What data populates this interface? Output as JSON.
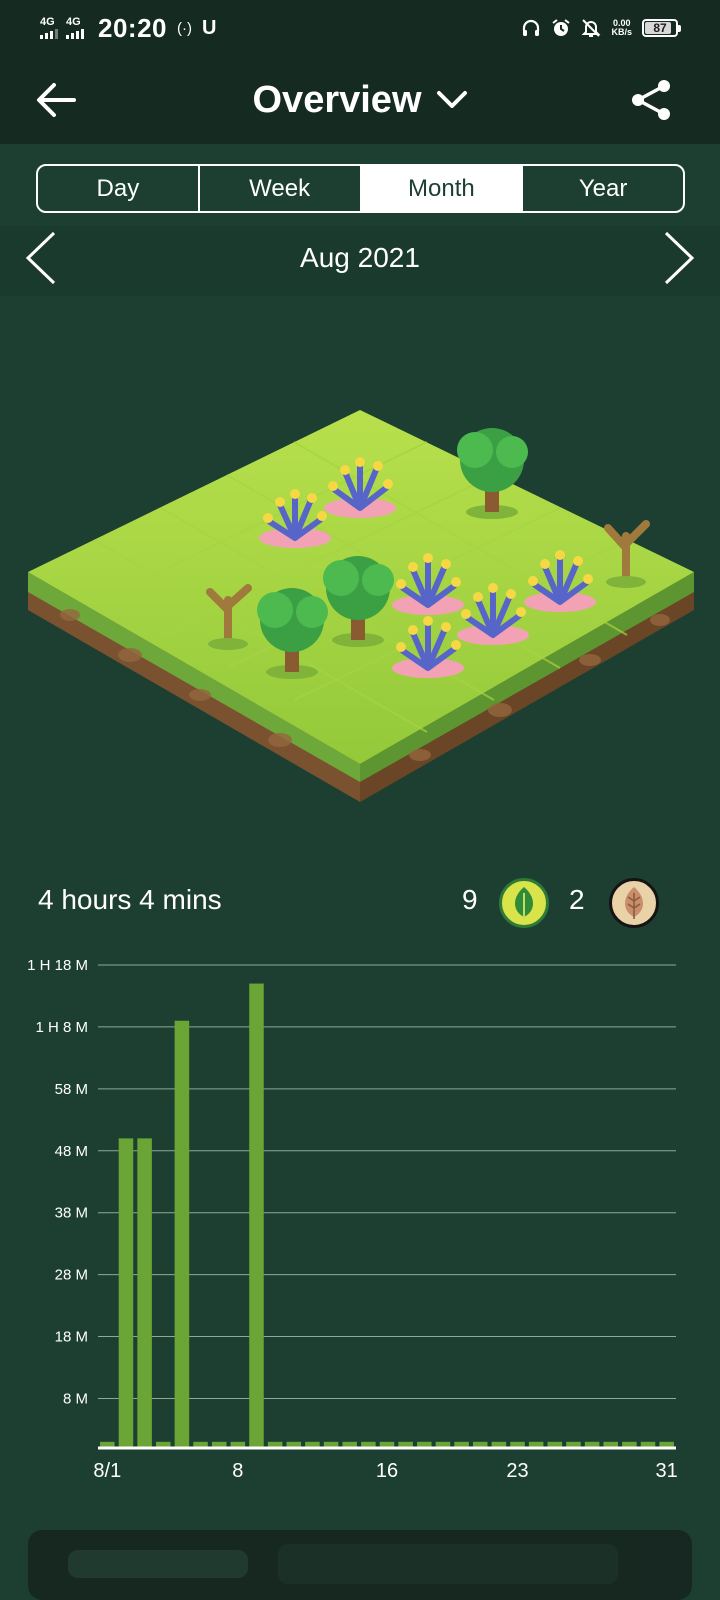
{
  "status_bar": {
    "net1": "4G",
    "net2": "4G",
    "time": "20:20",
    "hotspot": "(·)",
    "u_icon": "U",
    "speed_value": "0.00",
    "speed_unit": "KB/s",
    "battery": "87",
    "battery_level": 0.87,
    "icons": [
      "headphones-icon",
      "alarm-icon",
      "bell-off-icon"
    ]
  },
  "header": {
    "title": "Overview"
  },
  "tabs": [
    {
      "label": "Day",
      "active": false
    },
    {
      "label": "Week",
      "active": false
    },
    {
      "label": "Month",
      "active": true
    },
    {
      "label": "Year",
      "active": false
    }
  ],
  "period": {
    "label": "Aug 2021"
  },
  "summary": {
    "total_time": "4 hours 4 mins",
    "healthy_count": "9",
    "dead_count": "2"
  },
  "colors": {
    "background": "#1d3f32",
    "header": "#152a21",
    "bar": "#6aa535",
    "grid": "#8fa89a"
  },
  "chart_data": {
    "type": "bar",
    "categories": [
      "1",
      "2",
      "3",
      "4",
      "5",
      "6",
      "7",
      "8",
      "9",
      "10",
      "11",
      "12",
      "13",
      "14",
      "15",
      "16",
      "17",
      "18",
      "19",
      "20",
      "21",
      "22",
      "23",
      "24",
      "25",
      "26",
      "27",
      "28",
      "29",
      "30",
      "31"
    ],
    "values": [
      1,
      50,
      50,
      1,
      69,
      1,
      1,
      1,
      75,
      1,
      1,
      1,
      1,
      1,
      1,
      1,
      1,
      1,
      1,
      1,
      1,
      1,
      1,
      1,
      1,
      1,
      1,
      1,
      1,
      1,
      1
    ],
    "units": "minutes",
    "xtick_labels": [
      {
        "day": 1,
        "label": "8/1"
      },
      {
        "day": 8,
        "label": "8"
      },
      {
        "day": 16,
        "label": "16"
      },
      {
        "day": 23,
        "label": "23"
      },
      {
        "day": 31,
        "label": "31"
      }
    ],
    "yticks": [
      {
        "value": 8,
        "label": "8 M"
      },
      {
        "value": 18,
        "label": "18 M"
      },
      {
        "value": 28,
        "label": "28 M"
      },
      {
        "value": 38,
        "label": "38 M"
      },
      {
        "value": 48,
        "label": "48 M"
      },
      {
        "value": 58,
        "label": "58 M"
      },
      {
        "value": 68,
        "label": "1 H 8 M"
      },
      {
        "value": 78,
        "label": "1 H 18 M"
      }
    ],
    "ylim": [
      0,
      78
    ],
    "grid": true
  }
}
